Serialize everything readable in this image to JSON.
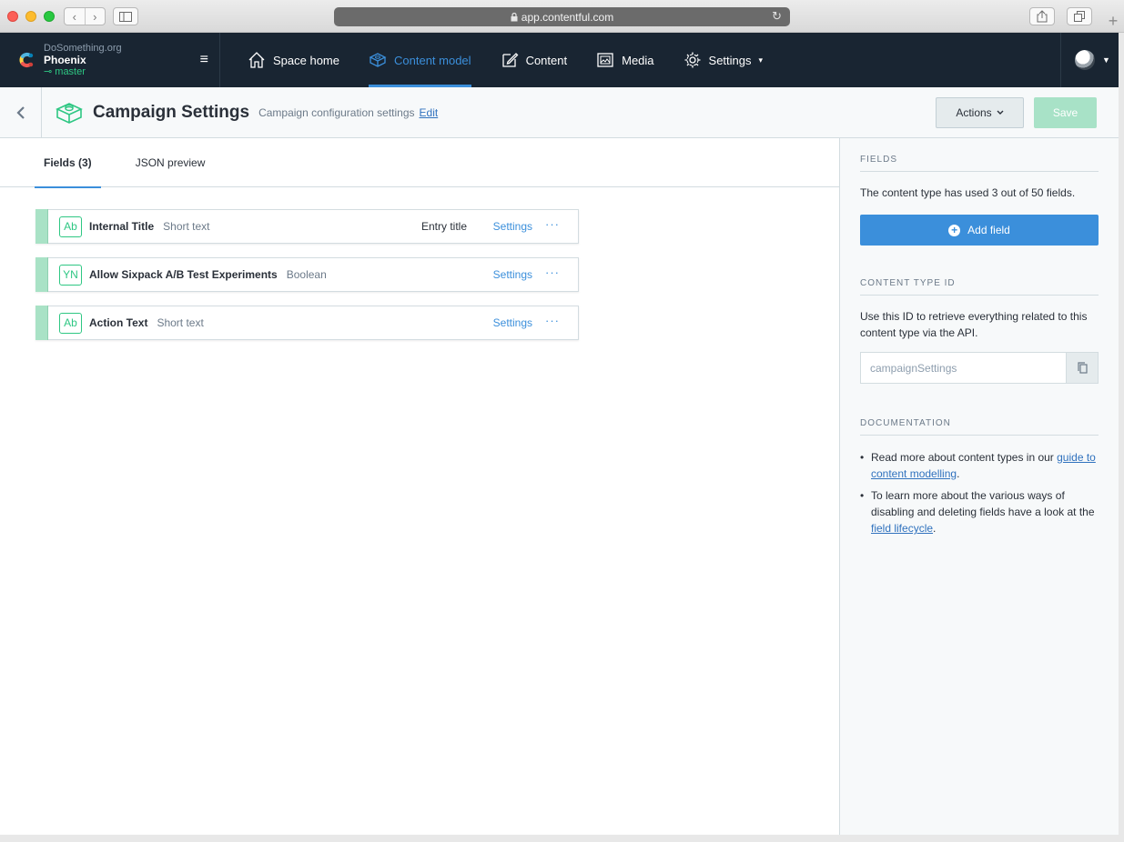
{
  "browser": {
    "url": "app.contentful.com",
    "lock_icon": "lock-icon",
    "reload_icon": "reload-icon"
  },
  "topnav": {
    "space": {
      "org": "DoSomething.org",
      "name": "Phoenix",
      "environment": "master"
    },
    "items": [
      {
        "label": "Space home",
        "icon": "house-icon"
      },
      {
        "label": "Content model",
        "icon": "cube-icon",
        "active": true
      },
      {
        "label": "Content",
        "icon": "edit-icon"
      },
      {
        "label": "Media",
        "icon": "image-icon"
      },
      {
        "label": "Settings",
        "icon": "gear-icon"
      }
    ]
  },
  "header": {
    "title": "Campaign Settings",
    "description": "Campaign configuration settings",
    "edit_label": "Edit",
    "actions_label": "Actions",
    "save_label": "Save"
  },
  "tabs": [
    {
      "label": "Fields (3)",
      "active": true
    },
    {
      "label": "JSON preview",
      "active": false
    }
  ],
  "fields": [
    {
      "badge": "Ab",
      "name": "Internal Title",
      "type": "Short text",
      "entry_title": "Entry title",
      "settings": "Settings",
      "more": "···"
    },
    {
      "badge": "YN",
      "name": "Allow Sixpack A/B Test Experiments",
      "type": "Boolean",
      "entry_title": "",
      "settings": "Settings",
      "more": "···"
    },
    {
      "badge": "Ab",
      "name": "Action Text",
      "type": "Short text",
      "entry_title": "",
      "settings": "Settings",
      "more": "···"
    }
  ],
  "sidebar": {
    "fields_heading": "FIELDS",
    "fields_text": "The content type has used 3 out of 50 fields.",
    "add_field_label": "Add field",
    "ctid_heading": "CONTENT TYPE ID",
    "ctid_text": "Use this ID to retrieve everything related to this content type via the API.",
    "ctid_value": "campaignSettings",
    "doc_heading": "DOCUMENTATION",
    "doc1_pre": "Read more about content types in our ",
    "doc1_link": "guide to content modelling",
    "doc1_post": ".",
    "doc2_pre": "To learn more about the various ways of disabling and deleting fields have a look at the ",
    "doc2_link": "field lifecycle",
    "doc2_post": "."
  },
  "colors": {
    "nav_bg": "#192532",
    "accent_blue": "#3b8fdb",
    "accent_green": "#2ec783",
    "save_disabled": "#a8e2c7"
  }
}
